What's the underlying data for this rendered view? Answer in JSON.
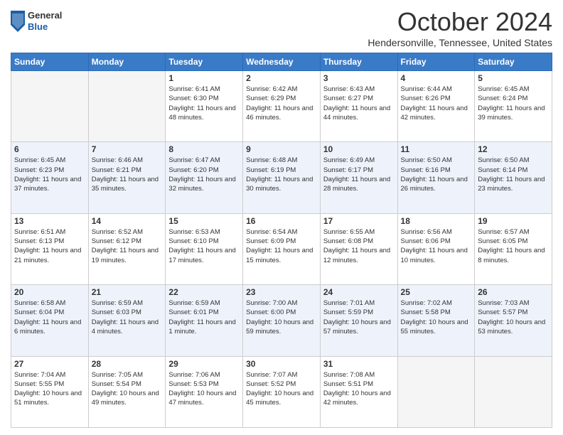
{
  "header": {
    "logo_general": "General",
    "logo_blue": "Blue",
    "month": "October 2024",
    "location": "Hendersonville, Tennessee, United States"
  },
  "weekdays": [
    "Sunday",
    "Monday",
    "Tuesday",
    "Wednesday",
    "Thursday",
    "Friday",
    "Saturday"
  ],
  "weeks": [
    [
      {
        "day": "",
        "info": ""
      },
      {
        "day": "",
        "info": ""
      },
      {
        "day": "1",
        "info": "Sunrise: 6:41 AM\nSunset: 6:30 PM\nDaylight: 11 hours and 48 minutes."
      },
      {
        "day": "2",
        "info": "Sunrise: 6:42 AM\nSunset: 6:29 PM\nDaylight: 11 hours and 46 minutes."
      },
      {
        "day": "3",
        "info": "Sunrise: 6:43 AM\nSunset: 6:27 PM\nDaylight: 11 hours and 44 minutes."
      },
      {
        "day": "4",
        "info": "Sunrise: 6:44 AM\nSunset: 6:26 PM\nDaylight: 11 hours and 42 minutes."
      },
      {
        "day": "5",
        "info": "Sunrise: 6:45 AM\nSunset: 6:24 PM\nDaylight: 11 hours and 39 minutes."
      }
    ],
    [
      {
        "day": "6",
        "info": "Sunrise: 6:45 AM\nSunset: 6:23 PM\nDaylight: 11 hours and 37 minutes."
      },
      {
        "day": "7",
        "info": "Sunrise: 6:46 AM\nSunset: 6:21 PM\nDaylight: 11 hours and 35 minutes."
      },
      {
        "day": "8",
        "info": "Sunrise: 6:47 AM\nSunset: 6:20 PM\nDaylight: 11 hours and 32 minutes."
      },
      {
        "day": "9",
        "info": "Sunrise: 6:48 AM\nSunset: 6:19 PM\nDaylight: 11 hours and 30 minutes."
      },
      {
        "day": "10",
        "info": "Sunrise: 6:49 AM\nSunset: 6:17 PM\nDaylight: 11 hours and 28 minutes."
      },
      {
        "day": "11",
        "info": "Sunrise: 6:50 AM\nSunset: 6:16 PM\nDaylight: 11 hours and 26 minutes."
      },
      {
        "day": "12",
        "info": "Sunrise: 6:50 AM\nSunset: 6:14 PM\nDaylight: 11 hours and 23 minutes."
      }
    ],
    [
      {
        "day": "13",
        "info": "Sunrise: 6:51 AM\nSunset: 6:13 PM\nDaylight: 11 hours and 21 minutes."
      },
      {
        "day": "14",
        "info": "Sunrise: 6:52 AM\nSunset: 6:12 PM\nDaylight: 11 hours and 19 minutes."
      },
      {
        "day": "15",
        "info": "Sunrise: 6:53 AM\nSunset: 6:10 PM\nDaylight: 11 hours and 17 minutes."
      },
      {
        "day": "16",
        "info": "Sunrise: 6:54 AM\nSunset: 6:09 PM\nDaylight: 11 hours and 15 minutes."
      },
      {
        "day": "17",
        "info": "Sunrise: 6:55 AM\nSunset: 6:08 PM\nDaylight: 11 hours and 12 minutes."
      },
      {
        "day": "18",
        "info": "Sunrise: 6:56 AM\nSunset: 6:06 PM\nDaylight: 11 hours and 10 minutes."
      },
      {
        "day": "19",
        "info": "Sunrise: 6:57 AM\nSunset: 6:05 PM\nDaylight: 11 hours and 8 minutes."
      }
    ],
    [
      {
        "day": "20",
        "info": "Sunrise: 6:58 AM\nSunset: 6:04 PM\nDaylight: 11 hours and 6 minutes."
      },
      {
        "day": "21",
        "info": "Sunrise: 6:59 AM\nSunset: 6:03 PM\nDaylight: 11 hours and 4 minutes."
      },
      {
        "day": "22",
        "info": "Sunrise: 6:59 AM\nSunset: 6:01 PM\nDaylight: 11 hours and 1 minute."
      },
      {
        "day": "23",
        "info": "Sunrise: 7:00 AM\nSunset: 6:00 PM\nDaylight: 10 hours and 59 minutes."
      },
      {
        "day": "24",
        "info": "Sunrise: 7:01 AM\nSunset: 5:59 PM\nDaylight: 10 hours and 57 minutes."
      },
      {
        "day": "25",
        "info": "Sunrise: 7:02 AM\nSunset: 5:58 PM\nDaylight: 10 hours and 55 minutes."
      },
      {
        "day": "26",
        "info": "Sunrise: 7:03 AM\nSunset: 5:57 PM\nDaylight: 10 hours and 53 minutes."
      }
    ],
    [
      {
        "day": "27",
        "info": "Sunrise: 7:04 AM\nSunset: 5:55 PM\nDaylight: 10 hours and 51 minutes."
      },
      {
        "day": "28",
        "info": "Sunrise: 7:05 AM\nSunset: 5:54 PM\nDaylight: 10 hours and 49 minutes."
      },
      {
        "day": "29",
        "info": "Sunrise: 7:06 AM\nSunset: 5:53 PM\nDaylight: 10 hours and 47 minutes."
      },
      {
        "day": "30",
        "info": "Sunrise: 7:07 AM\nSunset: 5:52 PM\nDaylight: 10 hours and 45 minutes."
      },
      {
        "day": "31",
        "info": "Sunrise: 7:08 AM\nSunset: 5:51 PM\nDaylight: 10 hours and 42 minutes."
      },
      {
        "day": "",
        "info": ""
      },
      {
        "day": "",
        "info": ""
      }
    ]
  ]
}
